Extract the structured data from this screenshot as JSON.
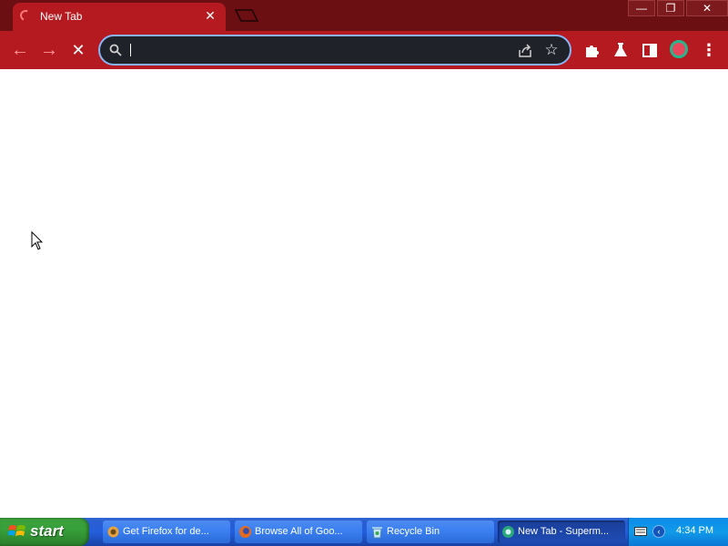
{
  "browser": {
    "tab": {
      "title": "New Tab",
      "close_glyph": "✕"
    },
    "window_controls": {
      "minimize_glyph": "—",
      "restore_glyph": "❐",
      "close_glyph": "✕"
    },
    "toolbar": {
      "back_glyph": "←",
      "forward_glyph": "→",
      "stop_glyph": "✕",
      "menu_glyph": "⋮",
      "star_glyph": "☆"
    },
    "omnibox": {
      "value": "",
      "placeholder": ""
    },
    "colors": {
      "frame": "#6b0f13",
      "toolbar": "#b51a20",
      "omnibox": "#1f2229",
      "omnibox_border": "#8ab4f8"
    }
  },
  "taskbar": {
    "start_label": "start",
    "tasks": [
      {
        "label": "Get Firefox for de...",
        "icon": "firefox-setup-icon"
      },
      {
        "label": "Browse All of Goo...",
        "icon": "firefox-icon"
      },
      {
        "label": "Recycle Bin",
        "icon": "recycle-bin-icon"
      },
      {
        "label": "New Tab - Superm...",
        "icon": "browser-icon",
        "active": true
      }
    ],
    "clock": "4:34 PM"
  }
}
